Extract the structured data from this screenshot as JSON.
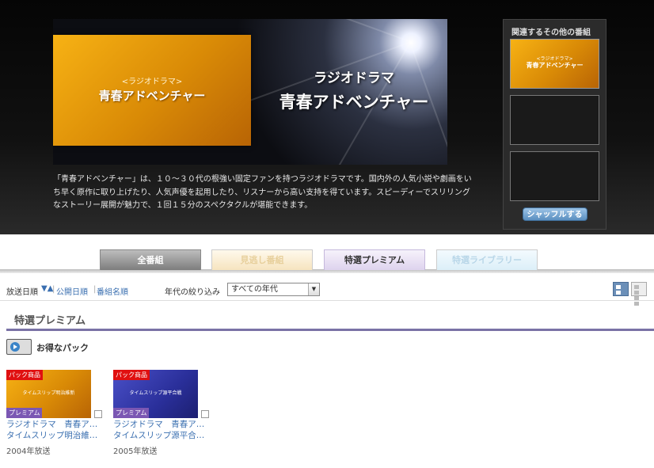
{
  "hero": {
    "thumb_sub": "<ラジオドラマ>",
    "thumb_title": "青春アドベンチャー",
    "title_sub": "ラジオドラマ",
    "title_main": "青春アドベンチャー",
    "description": "「青春アドベンチャー」は、１０～３０代の根強い固定ファンを持つラジオドラマです。国内外の人気小説や劇画をいち早く原作に取り上げたり、人気声優を起用したり、リスナーから高い支持を得ています。スピーディーでスリリングなストーリー展開が魅力で、１回１５分のスペクタクルが堪能できます。"
  },
  "related": {
    "heading": "関連するその他の番組",
    "thumb1_sub": "<ラジオドラマ>",
    "thumb1_title": "青春アドベンチャー",
    "shuffle_label": "シャッフルする"
  },
  "tabs": {
    "all": "全番組",
    "missed": "見逃し番組",
    "premium": "特選プレミアム",
    "library": "特選ライブラリー"
  },
  "sortbar": {
    "broadcast_date": "放送日順",
    "arrows": "▼▲",
    "sep": "|",
    "publish_date": "公開日順",
    "program_name": "番組名順",
    "filter_label": "年代の絞り込み",
    "filter_value": "すべての年代",
    "dropdown_arrow": "▼"
  },
  "section": {
    "title": "特選プレミアム",
    "pack_label": "お得なパック"
  },
  "cards": [
    {
      "badge": "パック商品",
      "caption": "タイムスリップ明治維新",
      "tag": "プレミアム",
      "title1": "ラジオドラマ　青春ア…",
      "title2": "タイムスリップ明治維…",
      "year": "2004年放送"
    },
    {
      "badge": "パック商品",
      "caption": "タイムスリップ源平合戦",
      "tag": "プレミアム",
      "title1": "ラジオドラマ　青春ア…",
      "title2": "タイムスリップ源平合…",
      "year": "2005年放送"
    }
  ],
  "colors": {
    "accent_blue": "#3a6fb0",
    "premium_purple": "#7b57b3",
    "badge_red": "#e01010"
  }
}
